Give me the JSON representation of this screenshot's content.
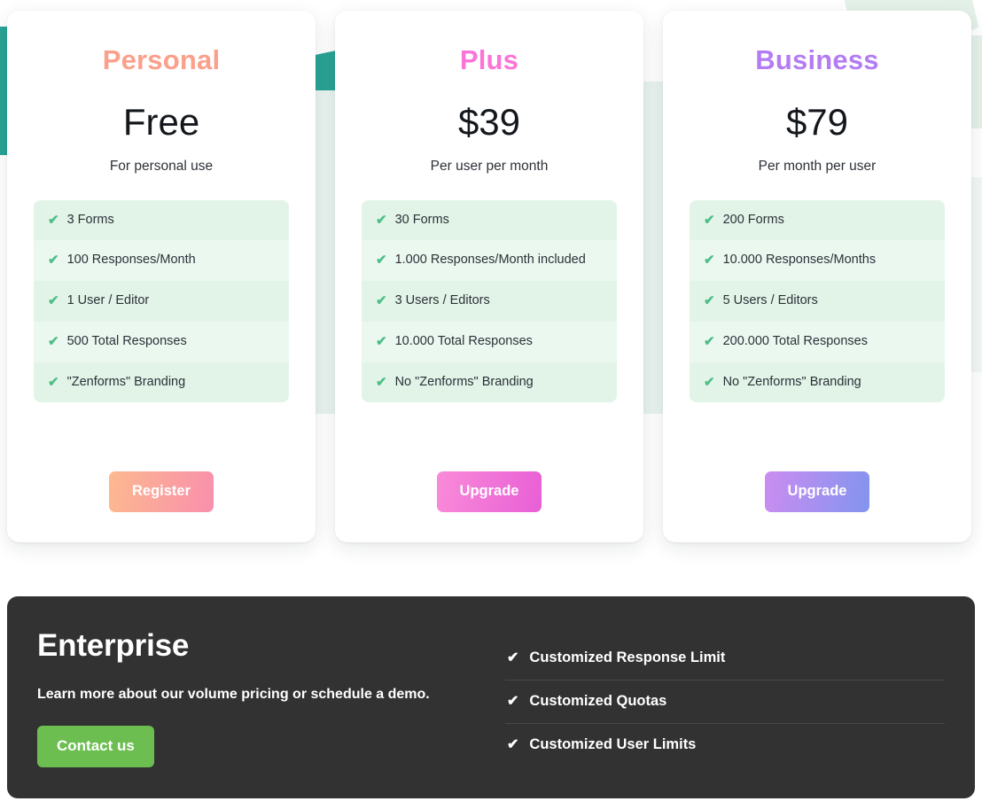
{
  "plans": [
    {
      "name": "Personal",
      "accent": "#fba08a",
      "price": "Free",
      "caption": "For personal use",
      "features": [
        "3 Forms",
        "100 Responses/Month",
        "1 User / Editor",
        "500 Total Responses",
        "\"Zenforms\" Branding"
      ],
      "cta_label": "Register"
    },
    {
      "name": "Plus",
      "accent": "#fb74d7",
      "price": "$39",
      "caption": "Per user per month",
      "features": [
        "30 Forms",
        "1.000 Responses/Month included",
        "3 Users / Editors",
        "10.000 Total Responses",
        "No \"Zenforms\" Branding"
      ],
      "cta_label": "Upgrade"
    },
    {
      "name": "Business",
      "accent": "#b47cf2",
      "price": "$79",
      "caption": "Per month per user",
      "features": [
        "200 Forms",
        "10.000 Responses/Months",
        "5 Users / Editors",
        "200.000 Total Responses",
        "No \"Zenforms\" Branding"
      ],
      "cta_label": "Upgrade"
    }
  ],
  "enterprise": {
    "title": "Enterprise",
    "subtitle": "Learn more about our volume pricing or schedule a demo.",
    "cta_label": "Contact us",
    "cta_color": "#6cbe50",
    "background": "#323232",
    "features": [
      "Customized Response Limit",
      "Customized Quotas",
      "Customized User Limits"
    ]
  },
  "icons": {
    "check": "✔"
  }
}
